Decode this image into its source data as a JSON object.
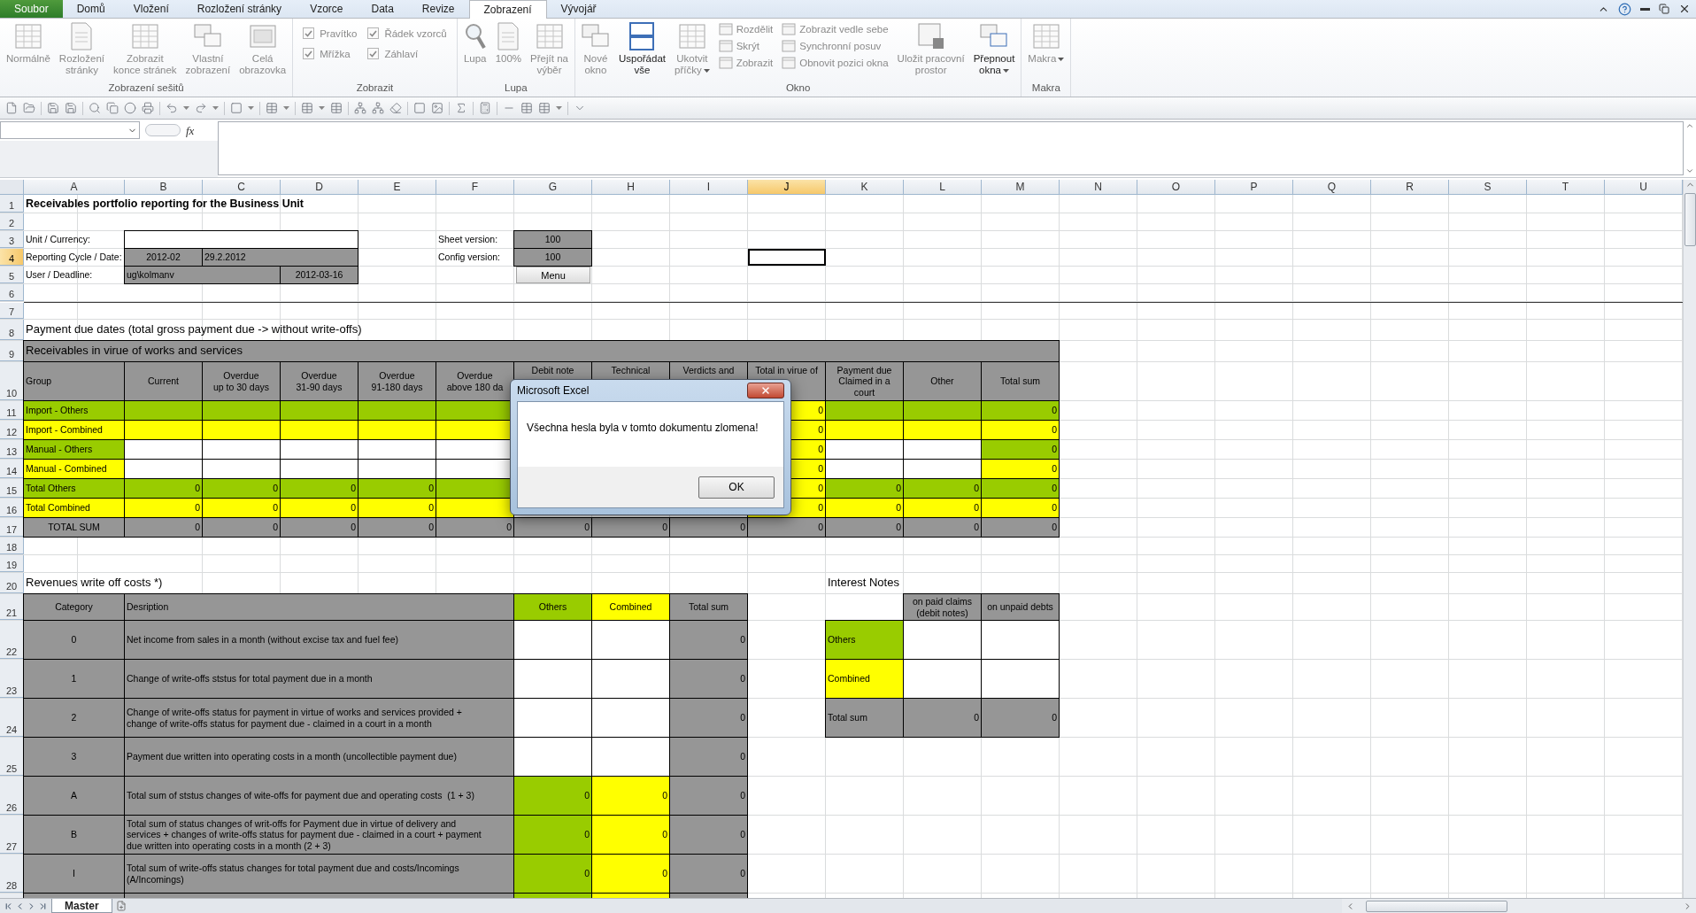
{
  "menu_tabs": [
    {
      "label": "Soubor",
      "kind": "file",
      "selected": false
    },
    {
      "label": "Domů",
      "kind": "tab",
      "selected": false
    },
    {
      "label": "Vložení",
      "kind": "tab",
      "selected": false
    },
    {
      "label": "Rozložení stránky",
      "kind": "tab",
      "selected": false
    },
    {
      "label": "Vzorce",
      "kind": "tab",
      "selected": false
    },
    {
      "label": "Data",
      "kind": "tab",
      "selected": false
    },
    {
      "label": "Revize",
      "kind": "tab",
      "selected": false
    },
    {
      "label": "Zobrazení",
      "kind": "tab",
      "selected": true
    },
    {
      "label": "Vývojář",
      "kind": "tab",
      "selected": false
    }
  ],
  "ribbon": {
    "groups": [
      {
        "label": "Zobrazení sešitů",
        "items": [
          {
            "kind": "large",
            "label": "Normálně",
            "disabled": true,
            "dropdown": false
          },
          {
            "kind": "large",
            "label": "Rozložení\nstránky",
            "disabled": true,
            "dropdown": false
          },
          {
            "kind": "large",
            "label": "Zobrazit\nkonce stránek",
            "disabled": true,
            "dropdown": false
          },
          {
            "kind": "large",
            "label": "Vlastní\nzobrazení",
            "disabled": true,
            "dropdown": false
          },
          {
            "kind": "large",
            "label": "Celá\nobrazovka",
            "disabled": true,
            "dropdown": false
          }
        ]
      },
      {
        "label": "Zobrazit",
        "items": [
          {
            "kind": "checks",
            "items": [
              {
                "label": "Pravítko",
                "checked": true,
                "disabled": true
              },
              {
                "label": "Řádek vzorců",
                "checked": true,
                "disabled": true
              },
              {
                "label": "Mřížka",
                "checked": true,
                "disabled": true
              },
              {
                "label": "Záhlaví",
                "checked": true,
                "disabled": true
              }
            ]
          }
        ]
      },
      {
        "label": "Lupa",
        "items": [
          {
            "kind": "large",
            "label": "Lupa",
            "disabled": true,
            "dropdown": false
          },
          {
            "kind": "large",
            "label": "100%",
            "disabled": true,
            "dropdown": false
          },
          {
            "kind": "large",
            "label": "Přejít na\nvýběr",
            "disabled": true,
            "dropdown": false
          }
        ]
      },
      {
        "label": "Okno",
        "items": [
          {
            "kind": "large",
            "label": "Nové\nokno",
            "disabled": true,
            "dropdown": false
          },
          {
            "kind": "large",
            "label": "Uspořádat\nvše",
            "disabled": false,
            "dropdown": false
          },
          {
            "kind": "large",
            "label": "Ukotvit\npříčky",
            "disabled": true,
            "dropdown": true
          },
          {
            "kind": "stack",
            "items": [
              {
                "label": "Rozdělit",
                "disabled": true
              },
              {
                "label": "Skrýt",
                "disabled": true
              },
              {
                "label": "Zobrazit",
                "disabled": true
              }
            ]
          },
          {
            "kind": "stack",
            "items": [
              {
                "label": "Zobrazit vedle sebe",
                "disabled": true
              },
              {
                "label": "Synchronní posuv",
                "disabled": true
              },
              {
                "label": "Obnovit pozici okna",
                "disabled": true
              }
            ]
          },
          {
            "kind": "large",
            "label": "Uložit pracovní\nprostor",
            "disabled": true,
            "dropdown": false
          },
          {
            "kind": "large",
            "label": "Přepnout\nokna",
            "disabled": false,
            "dropdown": true
          }
        ]
      },
      {
        "label": "Makra",
        "items": [
          {
            "kind": "large",
            "label": "Makra",
            "disabled": true,
            "dropdown": true
          }
        ]
      }
    ]
  },
  "formula_bar": {
    "function_label": "fx"
  },
  "columns": [
    {
      "label": "A",
      "selected": false
    },
    {
      "label": "B",
      "selected": false
    },
    {
      "label": "C",
      "selected": false
    },
    {
      "label": "D",
      "selected": false
    },
    {
      "label": "E",
      "selected": false
    },
    {
      "label": "F",
      "selected": false
    },
    {
      "label": "G",
      "selected": false
    },
    {
      "label": "H",
      "selected": false
    },
    {
      "label": "I",
      "selected": false
    },
    {
      "label": "J",
      "selected": true
    },
    {
      "label": "K",
      "selected": false
    },
    {
      "label": "L",
      "selected": false
    },
    {
      "label": "M",
      "selected": false
    },
    {
      "label": "N",
      "selected": false
    },
    {
      "label": "O",
      "selected": false
    },
    {
      "label": "P",
      "selected": false
    },
    {
      "label": "Q",
      "selected": false
    },
    {
      "label": "R",
      "selected": false
    },
    {
      "label": "S",
      "selected": false
    },
    {
      "label": "T",
      "selected": false
    },
    {
      "label": "U",
      "selected": false
    }
  ],
  "rows": [
    {
      "number": "1",
      "selected": false,
      "cells": [
        {
          "text": "Receivables portfolio reporting for the Business Unit",
          "kind": "title"
        }
      ]
    },
    {
      "number": "2",
      "selected": false
    },
    {
      "number": "3",
      "selected": false,
      "cells": [
        {
          "text": "Unit / Currency:"
        },
        {
          "color": "#ffffff",
          "merged_with_next": true
        },
        {
          "color": "#ffffff",
          "merged_with_next": true
        },
        {
          "color": "#ffffff"
        },
        {},
        {
          "text": "Sheet version:"
        },
        {
          "text": "100",
          "kind": "center",
          "color": "#969696"
        }
      ]
    },
    {
      "number": "4",
      "selected": true,
      "cells": [
        {
          "text": "Reporting Cycle / Date:"
        },
        {
          "text": "2012-02",
          "kind": "center",
          "color": "#969696"
        },
        {
          "text": "29.2.2012",
          "color": "#969696",
          "merged_with_next": true
        },
        {
          "color": "#969696"
        },
        {},
        {
          "text": "Config version:"
        },
        {
          "text": "100",
          "kind": "center",
          "color": "#969696"
        }
      ]
    },
    {
      "number": "5",
      "selected": false,
      "cells": [
        {
          "text": "User / Deadline:"
        },
        {
          "text": "ug\\kolmanv",
          "color": "#969696",
          "merged_with_next": true
        },
        {
          "color": "#969696"
        },
        {
          "text": "2012-03-16",
          "kind": "center",
          "color": "#969696"
        },
        {},
        {},
        {
          "text": "Menu",
          "kind": "button"
        }
      ]
    },
    {
      "number": "6",
      "selected": false
    },
    {
      "number": "7",
      "selected": false,
      "freeze_line_above": true
    },
    {
      "number": "8",
      "selected": false,
      "cells": [
        {
          "text": "Payment due dates (total gross payment due -> without write-offs)",
          "kind": "heading"
        }
      ]
    },
    {
      "number": "9",
      "selected": false,
      "cells": [
        {
          "text": "Receivables in virue of works and services",
          "kind": "heading",
          "color": "#969696",
          "merged_with_next": true
        },
        {
          "color": "#969696",
          "merged_with_next": true
        },
        {
          "color": "#969696",
          "merged_with_next": true
        },
        {
          "color": "#969696",
          "merged_with_next": true
        },
        {
          "color": "#969696",
          "merged_with_next": true
        },
        {
          "color": "#969696",
          "merged_with_next": true
        },
        {
          "color": "#969696",
          "merged_with_next": true
        },
        {
          "color": "#969696",
          "merged_with_next": true
        },
        {
          "color": "#969696",
          "merged_with_next": true
        },
        {
          "color": "#969696",
          "merged_with_next": true
        },
        {
          "color": "#969696",
          "merged_with_next": true
        },
        {
          "color": "#969696",
          "merged_with_next": true
        },
        {
          "color": "#969696"
        }
      ]
    },
    {
      "number": "10",
      "selected": false,
      "cells": [
        {
          "text": "Group",
          "color": "#969696"
        },
        {
          "text": "Current",
          "kind": "center",
          "color": "#969696"
        },
        {
          "text": "Overdue\nup to 30 days",
          "kind": "center",
          "color": "#969696"
        },
        {
          "text": "Overdue\n31-90 days",
          "kind": "center",
          "color": "#969696"
        },
        {
          "text": "Overdue\n91-180 days",
          "kind": "center",
          "color": "#969696"
        },
        {
          "text": "Overdue\nabove 180 da",
          "kind": "center",
          "color": "#969696"
        },
        {
          "text": "Debit note",
          "kind": "top",
          "color": "#969696"
        },
        {
          "text": "Technical",
          "kind": "top",
          "color": "#969696"
        },
        {
          "text": "Verdicts and",
          "kind": "top",
          "color": "#969696"
        },
        {
          "text": "Total in virue of",
          "kind": "top",
          "color": "#969696"
        },
        {
          "text": "Payment due\nClaimed in a\ncourt",
          "kind": "center",
          "color": "#969696"
        },
        {
          "text": "Other",
          "kind": "center",
          "color": "#969696"
        },
        {
          "text": "Total sum",
          "kind": "center",
          "color": "#969696"
        }
      ]
    },
    {
      "number": "11",
      "selected": false,
      "cells": [
        {
          "text": "Import - Others",
          "color": "#99cc00"
        },
        {
          "color": "#99cc00"
        },
        {
          "color": "#99cc00"
        },
        {
          "color": "#99cc00"
        },
        {
          "color": "#99cc00"
        },
        {
          "color": "#99cc00"
        },
        {},
        {},
        {},
        {
          "text": "0",
          "kind": "number",
          "color": "#ffff00"
        },
        {
          "color": "#99cc00"
        },
        {
          "color": "#99cc00"
        },
        {
          "text": "0",
          "kind": "number",
          "color": "#99cc00"
        }
      ]
    },
    {
      "number": "12",
      "selected": false,
      "cells": [
        {
          "text": "Import - Combined",
          "color": "#ffff00"
        },
        {
          "color": "#ffff00"
        },
        {
          "color": "#ffff00"
        },
        {
          "color": "#ffff00"
        },
        {
          "color": "#ffff00"
        },
        {
          "color": "#ffff00"
        },
        {},
        {},
        {},
        {
          "text": "0",
          "kind": "number",
          "color": "#ffff00"
        },
        {
          "color": "#ffff00"
        },
        {
          "color": "#ffff00"
        },
        {
          "text": "0",
          "kind": "number",
          "color": "#ffff00"
        }
      ]
    },
    {
      "number": "13",
      "selected": false,
      "cells": [
        {
          "text": "Manual - Others",
          "color": "#99cc00"
        },
        {
          "color": "#ffffff"
        },
        {
          "color": "#ffffff"
        },
        {
          "color": "#ffffff"
        },
        {
          "color": "#ffffff"
        },
        {
          "color": "#ffffff"
        },
        {},
        {},
        {},
        {
          "text": "0",
          "kind": "number",
          "color": "#ffff00"
        },
        {
          "color": "#ffffff"
        },
        {
          "color": "#ffffff"
        },
        {
          "text": "0",
          "kind": "number",
          "color": "#99cc00"
        }
      ]
    },
    {
      "number": "14",
      "selected": false,
      "cells": [
        {
          "text": "Manual - Combined",
          "color": "#ffff00"
        },
        {
          "color": "#ffffff"
        },
        {
          "color": "#ffffff"
        },
        {
          "color": "#ffffff"
        },
        {
          "color": "#ffffff"
        },
        {
          "color": "#ffffff"
        },
        {},
        {},
        {},
        {
          "text": "0",
          "kind": "number",
          "color": "#ffff00"
        },
        {
          "color": "#ffffff"
        },
        {
          "color": "#ffffff"
        },
        {
          "text": "0",
          "kind": "number",
          "color": "#ffff00"
        }
      ]
    },
    {
      "number": "15",
      "selected": false,
      "cells": [
        {
          "text": "Total Others",
          "color": "#99cc00"
        },
        {
          "text": "0",
          "kind": "number",
          "color": "#99cc00"
        },
        {
          "text": "0",
          "kind": "number",
          "color": "#99cc00"
        },
        {
          "text": "0",
          "kind": "number",
          "color": "#99cc00"
        },
        {
          "text": "0",
          "kind": "number",
          "color": "#99cc00"
        },
        {
          "color": "#99cc00"
        },
        {},
        {},
        {},
        {
          "text": "0",
          "kind": "number",
          "color": "#ffff00"
        },
        {
          "text": "0",
          "kind": "number",
          "color": "#99cc00"
        },
        {
          "text": "0",
          "kind": "number",
          "color": "#99cc00"
        },
        {
          "text": "0",
          "kind": "number",
          "color": "#99cc00"
        }
      ]
    },
    {
      "number": "16",
      "selected": false,
      "cells": [
        {
          "text": "Total Combined",
          "color": "#ffff00"
        },
        {
          "text": "0",
          "kind": "number",
          "color": "#ffff00"
        },
        {
          "text": "0",
          "kind": "number",
          "color": "#ffff00"
        },
        {
          "text": "0",
          "kind": "number",
          "color": "#ffff00"
        },
        {
          "text": "0",
          "kind": "number",
          "color": "#ffff00"
        },
        {
          "color": "#ffff00"
        },
        {},
        {},
        {},
        {
          "text": "0",
          "kind": "number",
          "color": "#ffff00"
        },
        {
          "text": "0",
          "kind": "number",
          "color": "#ffff00"
        },
        {
          "text": "0",
          "kind": "number",
          "color": "#ffff00"
        },
        {
          "text": "0",
          "kind": "number",
          "color": "#ffff00"
        }
      ]
    },
    {
      "number": "17",
      "selected": false,
      "cells": [
        {
          "text": "TOTAL SUM",
          "kind": "center",
          "color": "#969696"
        },
        {
          "text": "0",
          "kind": "number",
          "color": "#969696"
        },
        {
          "text": "0",
          "kind": "number",
          "color": "#969696"
        },
        {
          "text": "0",
          "kind": "number",
          "color": "#969696"
        },
        {
          "text": "0",
          "kind": "number",
          "color": "#969696"
        },
        {
          "text": "0",
          "kind": "number",
          "color": "#969696"
        },
        {
          "text": "0",
          "kind": "number",
          "color": "#969696"
        },
        {
          "text": "0",
          "kind": "number",
          "color": "#969696"
        },
        {
          "text": "0",
          "kind": "number",
          "color": "#969696"
        },
        {
          "text": "0",
          "kind": "number",
          "color": "#969696"
        },
        {
          "text": "0",
          "kind": "number",
          "color": "#969696"
        },
        {
          "text": "0",
          "kind": "number",
          "color": "#969696"
        },
        {
          "text": "0",
          "kind": "number",
          "color": "#969696"
        }
      ]
    },
    {
      "number": "18",
      "selected": false
    },
    {
      "number": "19",
      "selected": false
    },
    {
      "number": "20",
      "selected": false,
      "cells": [
        {
          "text": "Revenues write off costs *)",
          "kind": "heading"
        },
        {},
        {},
        {},
        {},
        {},
        {},
        {},
        {},
        {},
        {
          "text": "Interest Notes",
          "kind": "heading"
        }
      ]
    },
    {
      "number": "21",
      "selected": false,
      "cells": [
        {
          "text": "Category",
          "kind": "center",
          "color": "#969696"
        },
        {
          "text": "Desription",
          "color": "#969696",
          "merged_with_next": true
        },
        {
          "color": "#969696",
          "merged_with_next": true
        },
        {
          "color": "#969696",
          "merged_with_next": true
        },
        {
          "color": "#969696",
          "merged_with_next": true
        },
        {
          "color": "#969696"
        },
        {
          "text": "Others",
          "kind": "center",
          "color": "#99cc00"
        },
        {
          "text": "Combined",
          "kind": "center",
          "color": "#ffff00"
        },
        {
          "text": "Total sum",
          "kind": "center",
          "color": "#969696"
        },
        {},
        {},
        {
          "text": "on paid claims\n(debit notes)",
          "kind": "center",
          "color": "#969696"
        },
        {
          "text": "on unpaid debts",
          "kind": "center",
          "color": "#969696"
        }
      ]
    },
    {
      "number": "22",
      "selected": false,
      "cells": [
        {
          "text": "0",
          "kind": "center",
          "color": "#969696"
        },
        {
          "text": "Net income from sales in a month (without excise tax and fuel fee)",
          "color": "#969696",
          "merged_with_next": true
        },
        {
          "color": "#969696",
          "merged_with_next": true
        },
        {
          "color": "#969696",
          "merged_with_next": true
        },
        {
          "color": "#969696",
          "merged_with_next": true
        },
        {
          "color": "#969696"
        },
        {
          "color": "#ffffff"
        },
        {
          "color": "#ffffff"
        },
        {
          "text": "0",
          "kind": "number",
          "color": "#969696"
        },
        {},
        {
          "text": "Others",
          "color": "#99cc00"
        },
        {
          "color": "#ffffff"
        },
        {
          "color": "#ffffff"
        }
      ]
    },
    {
      "number": "23",
      "selected": false,
      "cells": [
        {
          "text": "1",
          "kind": "center",
          "color": "#969696"
        },
        {
          "text": "Change of write-offs ststus for total payment due in a month",
          "color": "#969696",
          "merged_with_next": true
        },
        {
          "color": "#969696",
          "merged_with_next": true
        },
        {
          "color": "#969696",
          "merged_with_next": true
        },
        {
          "color": "#969696",
          "merged_with_next": true
        },
        {
          "color": "#969696"
        },
        {
          "color": "#ffffff"
        },
        {
          "color": "#ffffff"
        },
        {
          "text": "0",
          "kind": "number",
          "color": "#969696"
        },
        {},
        {
          "text": "Combined",
          "color": "#ffff00"
        },
        {
          "color": "#ffffff"
        },
        {
          "color": "#ffffff"
        }
      ]
    },
    {
      "number": "24",
      "selected": false,
      "cells": [
        {
          "text": "2",
          "kind": "center",
          "color": "#969696"
        },
        {
          "text": "Change of write-offs status for payment in virtue of works and services provided +\nchange of write-offs status for payment due - claimed in a court in a month",
          "color": "#969696",
          "merged_with_next": true
        },
        {
          "color": "#969696",
          "merged_with_next": true
        },
        {
          "color": "#969696",
          "merged_with_next": true
        },
        {
          "color": "#969696",
          "merged_with_next": true
        },
        {
          "color": "#969696"
        },
        {
          "color": "#ffffff"
        },
        {
          "color": "#ffffff"
        },
        {
          "text": "0",
          "kind": "number",
          "color": "#969696"
        },
        {},
        {
          "text": "Total sum",
          "color": "#969696"
        },
        {
          "text": "0",
          "kind": "number",
          "color": "#969696"
        },
        {
          "text": "0",
          "kind": "number",
          "color": "#969696"
        }
      ]
    },
    {
      "number": "25",
      "selected": false,
      "cells": [
        {
          "text": "3",
          "kind": "center",
          "color": "#969696"
        },
        {
          "text": "Payment due written into operating costs in a month (uncollectible payment due)",
          "color": "#969696",
          "merged_with_next": true
        },
        {
          "color": "#969696",
          "merged_with_next": true
        },
        {
          "color": "#969696",
          "merged_with_next": true
        },
        {
          "color": "#969696",
          "merged_with_next": true
        },
        {
          "color": "#969696"
        },
        {
          "color": "#ffffff"
        },
        {
          "color": "#ffffff"
        },
        {
          "text": "0",
          "kind": "number",
          "color": "#969696"
        }
      ]
    },
    {
      "number": "26",
      "selected": false,
      "cells": [
        {
          "text": "A",
          "kind": "center",
          "color": "#969696"
        },
        {
          "text": "Total sum of ststus changes of wite-offs for payment due and operating costs  (1 + 3)",
          "color": "#969696",
          "merged_with_next": true
        },
        {
          "color": "#969696",
          "merged_with_next": true
        },
        {
          "color": "#969696",
          "merged_with_next": true
        },
        {
          "color": "#969696",
          "merged_with_next": true
        },
        {
          "color": "#969696"
        },
        {
          "text": "0",
          "kind": "number",
          "color": "#99cc00"
        },
        {
          "text": "0",
          "kind": "number",
          "color": "#ffff00"
        },
        {
          "text": "0",
          "kind": "number",
          "color": "#969696"
        }
      ]
    },
    {
      "number": "27",
      "selected": false,
      "cells": [
        {
          "text": "B",
          "kind": "center",
          "color": "#969696"
        },
        {
          "text": "Total sum of status changes of writ-offs for Payment due in virtue of delivery and\nservices + changes of write-offs status for payment due - claimed in a court + payment\ndue written into operating costs in a month (2 + 3)",
          "color": "#969696",
          "merged_with_next": true
        },
        {
          "color": "#969696",
          "merged_with_next": true
        },
        {
          "color": "#969696",
          "merged_with_next": true
        },
        {
          "color": "#969696",
          "merged_with_next": true
        },
        {
          "color": "#969696"
        },
        {
          "text": "0",
          "kind": "number",
          "color": "#99cc00"
        },
        {
          "text": "0",
          "kind": "number",
          "color": "#ffff00"
        },
        {
          "text": "0",
          "kind": "number",
          "color": "#969696"
        }
      ]
    },
    {
      "number": "28",
      "selected": false,
      "cells": [
        {
          "text": "I",
          "kind": "center",
          "color": "#969696"
        },
        {
          "text": "Total sum of write-offs status changes for total payment due and costs/Incomings\n(A/Incomings)",
          "color": "#969696",
          "merged_with_next": true
        },
        {
          "color": "#969696",
          "merged_with_next": true
        },
        {
          "color": "#969696",
          "merged_with_next": true
        },
        {
          "color": "#969696",
          "merged_with_next": true
        },
        {
          "color": "#969696"
        },
        {
          "text": "0",
          "kind": "number",
          "color": "#99cc00"
        },
        {
          "text": "0",
          "kind": "number",
          "color": "#ffff00"
        },
        {
          "text": "0",
          "kind": "number",
          "color": "#969696"
        }
      ]
    },
    {
      "selected": false,
      "cells": [
        {
          "color": "#969696"
        },
        {
          "color": "#969696",
          "merged_with_next": true
        },
        {
          "color": "#969696",
          "merged_with_next": true
        },
        {
          "color": "#969696",
          "merged_with_next": true
        },
        {
          "color": "#969696",
          "merged_with_next": true
        },
        {
          "color": "#969696"
        },
        {
          "color": "#99cc00"
        },
        {
          "color": "#ffff00"
        },
        {
          "color": "#969696"
        }
      ]
    }
  ],
  "sheet_tabs": [
    {
      "label": "Master",
      "selected": true
    }
  ],
  "dialog": {
    "title": "Microsoft Excel",
    "message": "Všechna hesla byla v tomto dokumentu zlomena!",
    "buttons": [
      "OK"
    ]
  }
}
